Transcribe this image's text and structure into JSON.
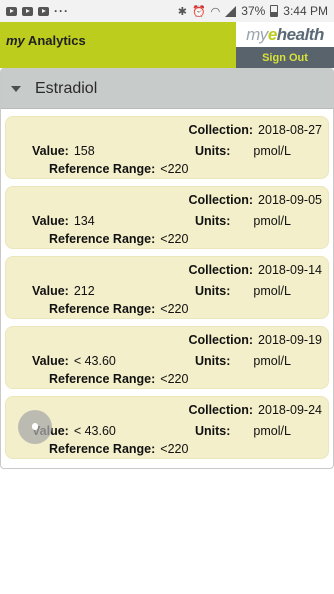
{
  "statusbar": {
    "battery": "37%",
    "time": "3:44 PM",
    "overflow": "···"
  },
  "header": {
    "title_prefix": "my",
    "title_main": " Analytics",
    "logo": {
      "my": "my",
      "e": "e",
      "health": "health"
    },
    "signout_label": "Sign Out"
  },
  "panel": {
    "title": "Estradiol",
    "labels": {
      "collection": "Collection:",
      "value": "Value:",
      "units": "Units:",
      "reference_range": "Reference Range:"
    },
    "results": [
      {
        "collection": "2018-08-27",
        "value": "158",
        "units": "pmol/L",
        "reference_range": "<220"
      },
      {
        "collection": "2018-09-05",
        "value": "134",
        "units": "pmol/L",
        "reference_range": "<220"
      },
      {
        "collection": "2018-09-14",
        "value": "212",
        "units": "pmol/L",
        "reference_range": "<220"
      },
      {
        "collection": "2018-09-19",
        "value": "< 43.60",
        "units": "pmol/L",
        "reference_range": "<220"
      },
      {
        "collection": "2018-09-24",
        "value": "< 43.60",
        "units": "pmol/L",
        "reference_range": "<220"
      }
    ]
  },
  "colors": {
    "brand_green": "#bccd1e",
    "header_gray": "#c7cbc9",
    "card_bg": "#f3efca",
    "signout_bg": "#59636c"
  }
}
